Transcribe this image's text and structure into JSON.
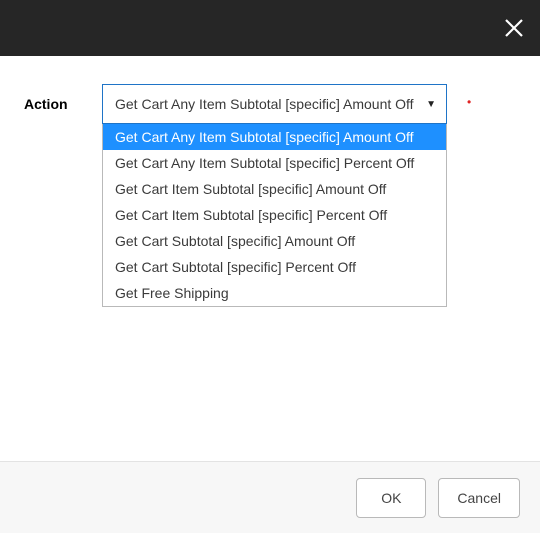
{
  "field": {
    "label": "Action",
    "required_marker": "•"
  },
  "select": {
    "value": "Get Cart Any Item Subtotal [specific] Amount Off",
    "options": [
      "Get Cart Any Item Subtotal [specific] Amount Off",
      "Get Cart Any Item Subtotal [specific] Percent Off",
      "Get Cart Item Subtotal [specific] Amount Off",
      "Get Cart Item Subtotal [specific] Percent Off",
      "Get Cart Subtotal [specific] Amount Off",
      "Get Cart Subtotal [specific] Percent Off",
      "Get Free Shipping"
    ],
    "selected_index": 0
  },
  "buttons": {
    "ok": "OK",
    "cancel": "Cancel"
  }
}
